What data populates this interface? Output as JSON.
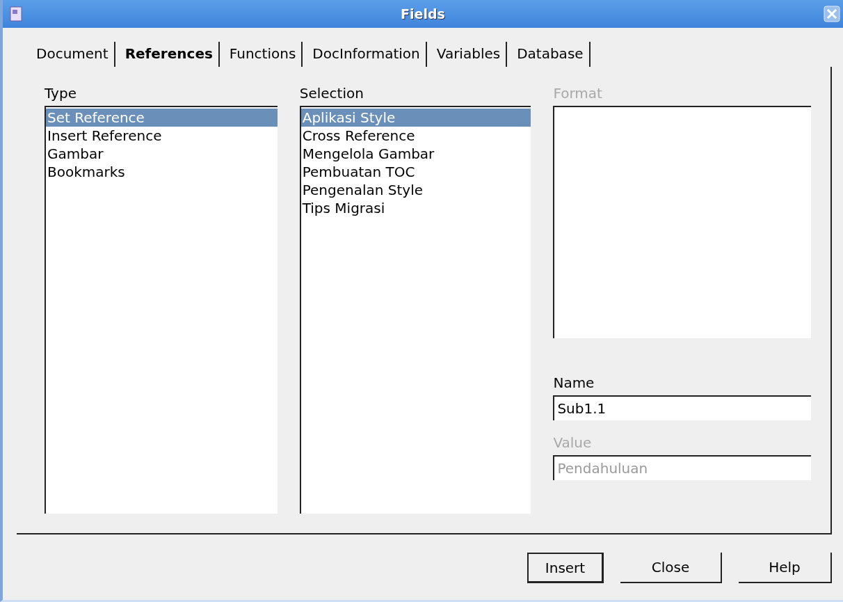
{
  "window": {
    "title": "Fields"
  },
  "tabs": [
    {
      "label": "Document",
      "selected": false
    },
    {
      "label": "References",
      "selected": true
    },
    {
      "label": "Functions",
      "selected": false
    },
    {
      "label": "DocInformation",
      "selected": false
    },
    {
      "label": "Variables",
      "selected": false
    },
    {
      "label": "Database",
      "selected": false
    }
  ],
  "type_list": {
    "label": "Type",
    "items": [
      {
        "label": "Set Reference",
        "selected": true
      },
      {
        "label": "Insert Reference",
        "selected": false
      },
      {
        "label": "Gambar",
        "selected": false
      },
      {
        "label": "Bookmarks",
        "selected": false
      }
    ]
  },
  "selection_list": {
    "label": "Selection",
    "items": [
      {
        "label": "Aplikasi Style",
        "selected": true
      },
      {
        "label": "Cross Reference",
        "selected": false
      },
      {
        "label": "Mengelola Gambar",
        "selected": false
      },
      {
        "label": "Pembuatan TOC",
        "selected": false
      },
      {
        "label": "Pengenalan Style",
        "selected": false
      },
      {
        "label": "Tips Migrasi",
        "selected": false
      }
    ]
  },
  "format_list": {
    "label": "Format",
    "disabled": true
  },
  "name_field": {
    "label": "Name",
    "value": "Sub1.1",
    "disabled": false
  },
  "value_field": {
    "label": "Value",
    "value": "Pendahuluan",
    "disabled": true
  },
  "buttons": [
    {
      "label": "Insert",
      "default": true
    },
    {
      "label": "Close",
      "default": false
    },
    {
      "label": "Help",
      "default": false
    }
  ]
}
